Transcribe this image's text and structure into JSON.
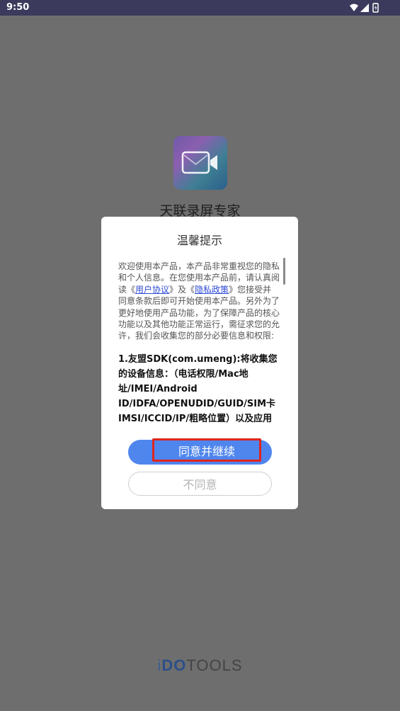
{
  "status_bar": {
    "time": "9:50",
    "icons": [
      "wifi-icon",
      "signal-icon",
      "battery-icon"
    ]
  },
  "splash": {
    "app_name": "天联录屏专家",
    "logo_icon": "video-camera-icon"
  },
  "dialog": {
    "title": "温馨提示",
    "intro_part1": "欢迎使用本产品，本产品非常重视您的隐私和个人信息。在您使用本产品前，请认真阅读《",
    "user_agreement_link": "用户协议",
    "intro_part2": "》及《",
    "privacy_policy_link": "隐私政策",
    "intro_part3": "》您接受并同意条款后即可开始使用本产品。另外为了更好地使用产品功能，为了保障产品的核心功能以及其他功能正常运行，需征求您的允许，我们会收集您的部分必要信息和权限:",
    "sdk_notice": "1.友盟SDK(com.umeng):将收集您的设备信息：（电话权限/Mac地址/IMEI/Android ID/IDFA/OPENUDID/GUID/SIM卡IMSI/ICCID/IP/粗略位置）以及应用安装列表和运行中进程",
    "agree_button": "同意并继续",
    "disagree_button": "不同意"
  },
  "brand": {
    "part1": "i",
    "part2": "DO",
    "part3": "TOOLS"
  },
  "colors": {
    "primary_button": "#4f86ee",
    "link": "#2e4bd6",
    "highlight_outline": "#e0251c",
    "status_bar": "#3b3a5c",
    "overlay": "#6e6e6e"
  }
}
